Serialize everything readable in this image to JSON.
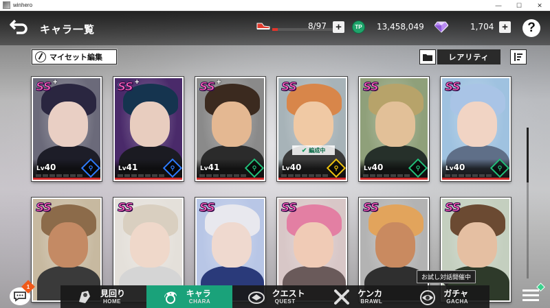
{
  "window": {
    "title": "winhero",
    "minimize": "—",
    "maximize": "☐",
    "close": "✕"
  },
  "header": {
    "title": "キャラ一覧",
    "stamina": "8/97",
    "stamina_fraction": 0.0825,
    "tp_label": "TP",
    "tp_value": "13,458,049",
    "gems": "1,704",
    "plus": "+",
    "help": "?"
  },
  "toolbar": {
    "myset_label": "マイセット編集",
    "sort_label": "レアリティ"
  },
  "cards": [
    {
      "rank": "SS",
      "plus": "+",
      "level": "40",
      "lv_prefix": "Lv",
      "attr_color": "#2e7cff",
      "attr_glyph": "⚲",
      "hair": "#2a2640",
      "skin": "#e9cfc4",
      "bg": "#6b6a7a",
      "cloth": "#1d1d28"
    },
    {
      "rank": "SS",
      "plus": "+",
      "level": "41",
      "lv_prefix": "Lv",
      "attr_color": "#2e7cff",
      "attr_glyph": "⚲",
      "hair": "#15344f",
      "skin": "#e8cdbf",
      "bg": "#4a2a6a",
      "cloth": "#1b1b22"
    },
    {
      "rank": "SS",
      "plus": "+",
      "level": "41",
      "lv_prefix": "Lv",
      "attr_color": "#22c07a",
      "attr_glyph": "⚲",
      "hair": "#3b2a1f",
      "skin": "#e4b892",
      "bg": "#8a8a8a",
      "cloth": "#2b2b2b"
    },
    {
      "rank": "SS",
      "plus": "",
      "level": "40",
      "lv_prefix": "Lv",
      "attr_color": "#f1c40f",
      "attr_glyph": "⚲",
      "hair": "#d8864a",
      "skin": "#f0c9a4",
      "bg": "#a7b3b8",
      "cloth": "#3a3a3a",
      "formation": "編成中"
    },
    {
      "rank": "SS",
      "plus": "",
      "level": "40",
      "lv_prefix": "Lv",
      "attr_color": "#22c07a",
      "attr_glyph": "⚲",
      "hair": "#b7a36a",
      "skin": "#e2c098",
      "bg": "#8fa07a",
      "cloth": "#26302a"
    },
    {
      "rank": "SS",
      "plus": "",
      "level": "40",
      "lv_prefix": "Lv",
      "attr_color": "#22c07a",
      "attr_glyph": "⚲",
      "hair": "#a9c4e6",
      "skin": "#f1d4c4",
      "bg": "#9fc2e0",
      "cloth": "#5f6f88"
    },
    {
      "rank": "SS",
      "plus": "",
      "level": "",
      "lv_prefix": "",
      "attr_color": "#888",
      "attr_glyph": "",
      "hair": "#8c6b4a",
      "skin": "#c48a64",
      "bg": "#c7b9a0",
      "cloth": "#3a3a3a"
    },
    {
      "rank": "SS",
      "plus": "",
      "level": "",
      "lv_prefix": "",
      "attr_color": "#888",
      "attr_glyph": "",
      "hair": "#d9cfc0",
      "skin": "#efd8ca",
      "bg": "#e4e0da",
      "cloth": "#d5d5d5"
    },
    {
      "rank": "SS",
      "plus": "",
      "level": "",
      "lv_prefix": "",
      "attr_color": "#888",
      "attr_glyph": "",
      "hair": "#e8e8ee",
      "skin": "#efd9cf",
      "bg": "#b8c6e6",
      "cloth": "#2a3a7a"
    },
    {
      "rank": "SS",
      "plus": "",
      "level": "",
      "lv_prefix": "",
      "attr_color": "#888",
      "attr_glyph": "",
      "hair": "#e37fa3",
      "skin": "#f0cbb6",
      "bg": "#d8c7c7",
      "cloth": "#6a5a5a"
    },
    {
      "rank": "SS",
      "plus": "",
      "level": "",
      "lv_prefix": "",
      "attr_color": "#888",
      "attr_glyph": "",
      "hair": "#e2a45c",
      "skin": "#c98a60",
      "bg": "#b3b3b3",
      "cloth": "#2f2f2f"
    },
    {
      "rank": "SS",
      "plus": "",
      "level": "",
      "lv_prefix": "",
      "attr_color": "#888",
      "attr_glyph": "",
      "hair": "#6b4a32",
      "skin": "#e5bfa2",
      "bg": "#c4cfbf",
      "cloth": "#2e3a2a"
    }
  ],
  "nav": {
    "items": [
      {
        "jp": "見回り",
        "en": "HOME"
      },
      {
        "jp": "キャラ",
        "en": "CHARA"
      },
      {
        "jp": "クエスト",
        "en": "QUEST"
      },
      {
        "jp": "ケンカ",
        "en": "BRAWL"
      },
      {
        "jp": "ガチャ",
        "en": "GACHA"
      }
    ],
    "trial_badge": "お試し対話開催中"
  },
  "chat_badge_count": "1",
  "colors": {
    "accent": "#1aa27a",
    "stamina": "#e3352b",
    "rank": "#ff5fbf"
  }
}
